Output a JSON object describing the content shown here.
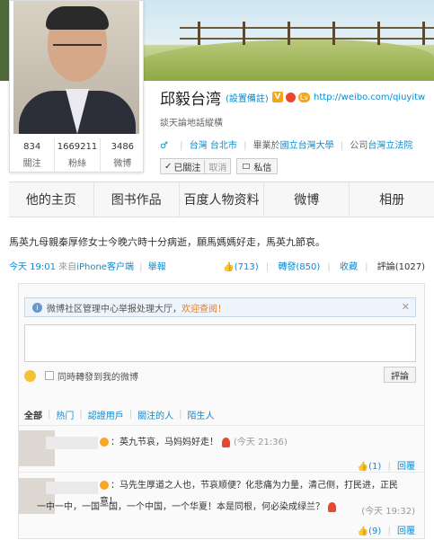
{
  "profile": {
    "name": "邱毅台湾",
    "remark_link": "(設置備註)",
    "v_badge": "V",
    "level_badge": "Lv",
    "homepage_url": "http://weibo.com/qiuyitw",
    "bio": "談天論地話縱橫",
    "gender_symbol": "♂",
    "location": "台灣 台北市",
    "education_prefix": "畢業於",
    "education": "國立台灣大學",
    "company_prefix": "公司",
    "company": "台灣立法院",
    "follow_button": "已關注",
    "cancel_link": "取消",
    "message_button": "私信"
  },
  "stats": [
    {
      "num": "834",
      "label": "關注"
    },
    {
      "num": "1669211",
      "label": "粉絲"
    },
    {
      "num": "3486",
      "label": "微博"
    }
  ],
  "tabs": [
    "他的主页",
    "图书作品",
    "百度人物资料",
    "微博",
    "相册"
  ],
  "post": {
    "text": "馬英九母親秦厚修女士今晚六時十分病逝，願馬媽媽好走，馬英九節哀。",
    "time": "今天 19:01",
    "source_prefix": "來自",
    "source": "iPhone客户端",
    "report": "舉報",
    "likes": "(713)",
    "repost": "轉發(850)",
    "favorite": "收藏",
    "comment": "評論(1027)"
  },
  "notice": {
    "label": "微博社区管理中心举报处理大厅，",
    "link": "欢迎查阅！",
    "close": "✕"
  },
  "comment_box": {
    "repost_checkbox": "同時轉發到我的微博",
    "submit": "評論"
  },
  "filters": [
    "全部",
    "热门",
    "認證用戶",
    "關注的人",
    "陌生人"
  ],
  "comments": [
    {
      "text": "：英九节哀，马妈妈好走！",
      "time": "(今天 21:36)",
      "likes": "(1)",
      "reply": "回覆"
    },
    {
      "line1": "：马先生厚道之人也，节哀顺便？化悲痛为力量，清己侧，打民进，正民意！",
      "line2": "一中一中，一国一国，一个中国，一个华夏！本是同根，何必染成绿兰？",
      "time": "(今天 19:32)",
      "likes": "(9)",
      "reply": "回覆"
    }
  ],
  "colors": {
    "link": "#0a8cd2",
    "notice_link": "#e67e22",
    "badge": "#f3a51c"
  }
}
